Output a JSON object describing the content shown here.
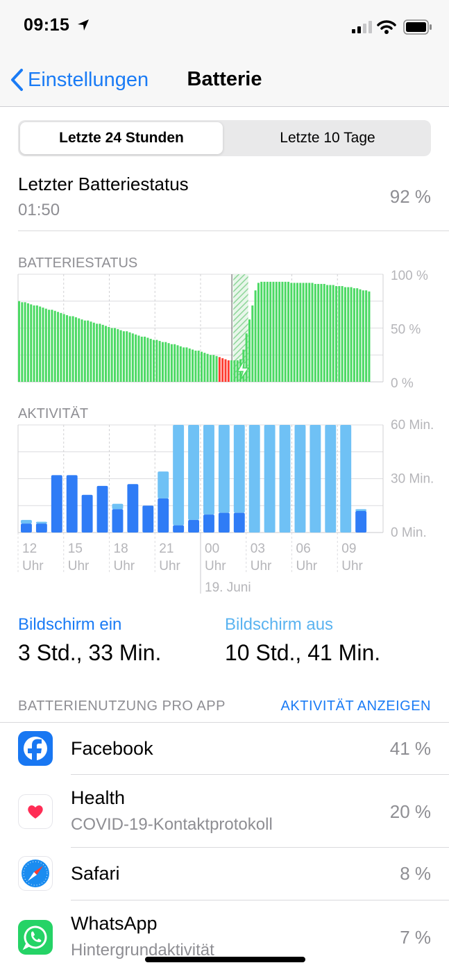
{
  "status_bar": {
    "time": "09:15"
  },
  "nav": {
    "back_label": "Einstellungen",
    "title": "Batterie"
  },
  "segments": {
    "active": "Letzte 24 Stunden",
    "inactive": "Letzte 10 Tage"
  },
  "last_status": {
    "label": "Letzter Batteriestatus",
    "time": "01:50",
    "value": "92 %"
  },
  "colors": {
    "accent": "#1a7bf5",
    "battery_green": "#4cd964",
    "battery_red": "#ff3b30",
    "screen_on": "#2f7cf6",
    "screen_off": "#6fc1f5"
  },
  "chart_data": [
    {
      "type": "bar",
      "title": "BATTERIESTATUS",
      "y_ticks": [
        "100 %",
        "50 %",
        "0 %"
      ],
      "ylim": [
        0,
        100
      ],
      "description_of_values": "battery level percent per time slot",
      "values": [
        75,
        74,
        74,
        73,
        72,
        71,
        71,
        70,
        69,
        68,
        67,
        67,
        66,
        65,
        64,
        63,
        62,
        61,
        61,
        60,
        59,
        58,
        57,
        57,
        56,
        55,
        54,
        54,
        53,
        52,
        51,
        50,
        50,
        49,
        48,
        47,
        47,
        46,
        45,
        44,
        43,
        42,
        42,
        41,
        40,
        39,
        39,
        38,
        37,
        37,
        36,
        35,
        35,
        34,
        33,
        32,
        32,
        31,
        30,
        29,
        29,
        28,
        27,
        26,
        25,
        25,
        24,
        23,
        22,
        21,
        20,
        20,
        20,
        20,
        21,
        30,
        45,
        58,
        71,
        85,
        92,
        93,
        93,
        93,
        93,
        93,
        93,
        93,
        93,
        93,
        93,
        92,
        92,
        92,
        92,
        92,
        92,
        92,
        92,
        91,
        91,
        91,
        91,
        90,
        90,
        90,
        89,
        89,
        89,
        88,
        88,
        88,
        87,
        87,
        86,
        85,
        85,
        84
      ],
      "low_range": [
        67,
        71
      ],
      "charging_range": [
        71,
        76
      ]
    },
    {
      "type": "bar",
      "title": "AKTIVITÄT",
      "y_ticks": [
        "60 Min.",
        "30 Min.",
        "0 Min."
      ],
      "ylim": [
        0,
        60
      ],
      "x_ticks": [
        {
          "hour": "12",
          "unit": "Uhr"
        },
        {
          "hour": "15",
          "unit": "Uhr"
        },
        {
          "hour": "18",
          "unit": "Uhr"
        },
        {
          "hour": "21",
          "unit": "Uhr"
        },
        {
          "hour": "00",
          "unit": "Uhr"
        },
        {
          "hour": "03",
          "unit": "Uhr"
        },
        {
          "hour": "06",
          "unit": "Uhr"
        },
        {
          "hour": "09",
          "unit": "Uhr"
        }
      ],
      "date_label": "19. Juni",
      "series": [
        {
          "name": "Bildschirm ein",
          "values": [
            5,
            5,
            32,
            32,
            21,
            26,
            13,
            27,
            15,
            19,
            4,
            7,
            10,
            11,
            11,
            0,
            0,
            0,
            0,
            0,
            0,
            0,
            12
          ]
        },
        {
          "name": "Bildschirm aus",
          "values": [
            2,
            1,
            0,
            0,
            0,
            0,
            3,
            0,
            0,
            15,
            56,
            53,
            50,
            49,
            49,
            60,
            60,
            60,
            60,
            60,
            60,
            60,
            1
          ]
        }
      ]
    }
  ],
  "screen_time": {
    "on_label": "Bildschirm ein",
    "on_value": "3 Std., 33 Min.",
    "off_label": "Bildschirm aus",
    "off_value": "10 Std., 41 Min."
  },
  "usage": {
    "caption": "BATTERIENUTZUNG PRO APP",
    "link": "AKTIVITÄT ANZEIGEN",
    "apps": [
      {
        "name": "Facebook",
        "sub": "",
        "pct": "41 %",
        "icon": "facebook-icon"
      },
      {
        "name": "Health",
        "sub": "COVID-19-Kontaktprotokoll",
        "pct": "20 %",
        "icon": "health-heart-icon"
      },
      {
        "name": "Safari",
        "sub": "",
        "pct": "8 %",
        "icon": "safari-compass-icon"
      },
      {
        "name": "WhatsApp",
        "sub": "Hintergrundaktivität",
        "pct": "7 %",
        "icon": "whatsapp-icon"
      }
    ]
  }
}
